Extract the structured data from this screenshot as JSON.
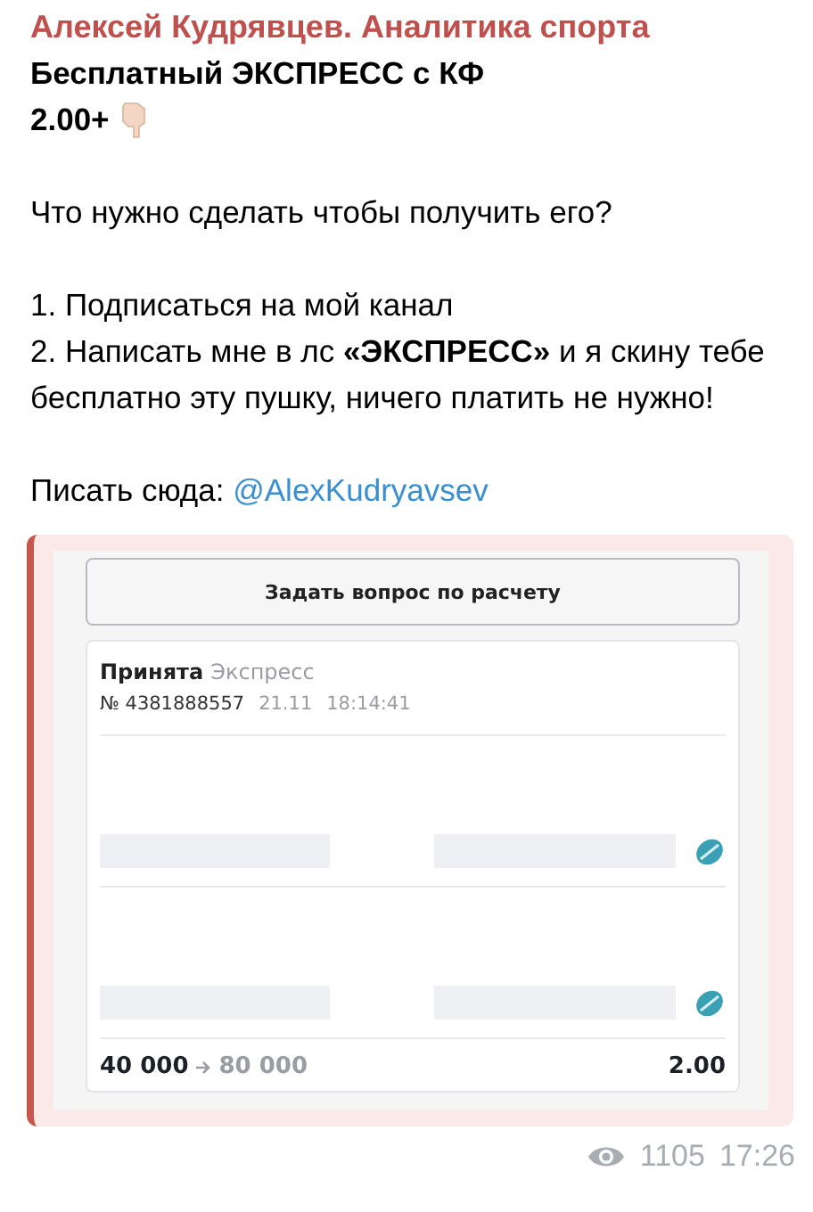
{
  "channel_name": "Алексей Кудрявцев. Аналитика спорта",
  "title": "Бесплатный ЭКСПРЕСС с КФ",
  "subtitle": "2.00+",
  "question": "Что нужно сделать чтобы получить его?",
  "steps": [
    "1. Подписаться на мой канал",
    "2. Написать мне в лс **«ЭКСПРЕСС»** и я скину тебе бесплатно эту пушку, ничего платить не нужно!"
  ],
  "contact": {
    "label": "Писать сюда:",
    "link": "@AlexKudryavsev"
  },
  "screenshot": {
    "button": "Задать вопрос по расчету",
    "bet": {
      "status": "Принята",
      "type": "Экспресс",
      "number": "№ 4381888557",
      "date": "21.11",
      "time": "18:14:41",
      "legs": [
        {
          "kind": "redacted"
        },
        {
          "kind": "redacted"
        }
      ],
      "stake": "40 000",
      "payout": "80 000",
      "odds": "2.00"
    }
  },
  "views": "1105",
  "time": "17:26"
}
